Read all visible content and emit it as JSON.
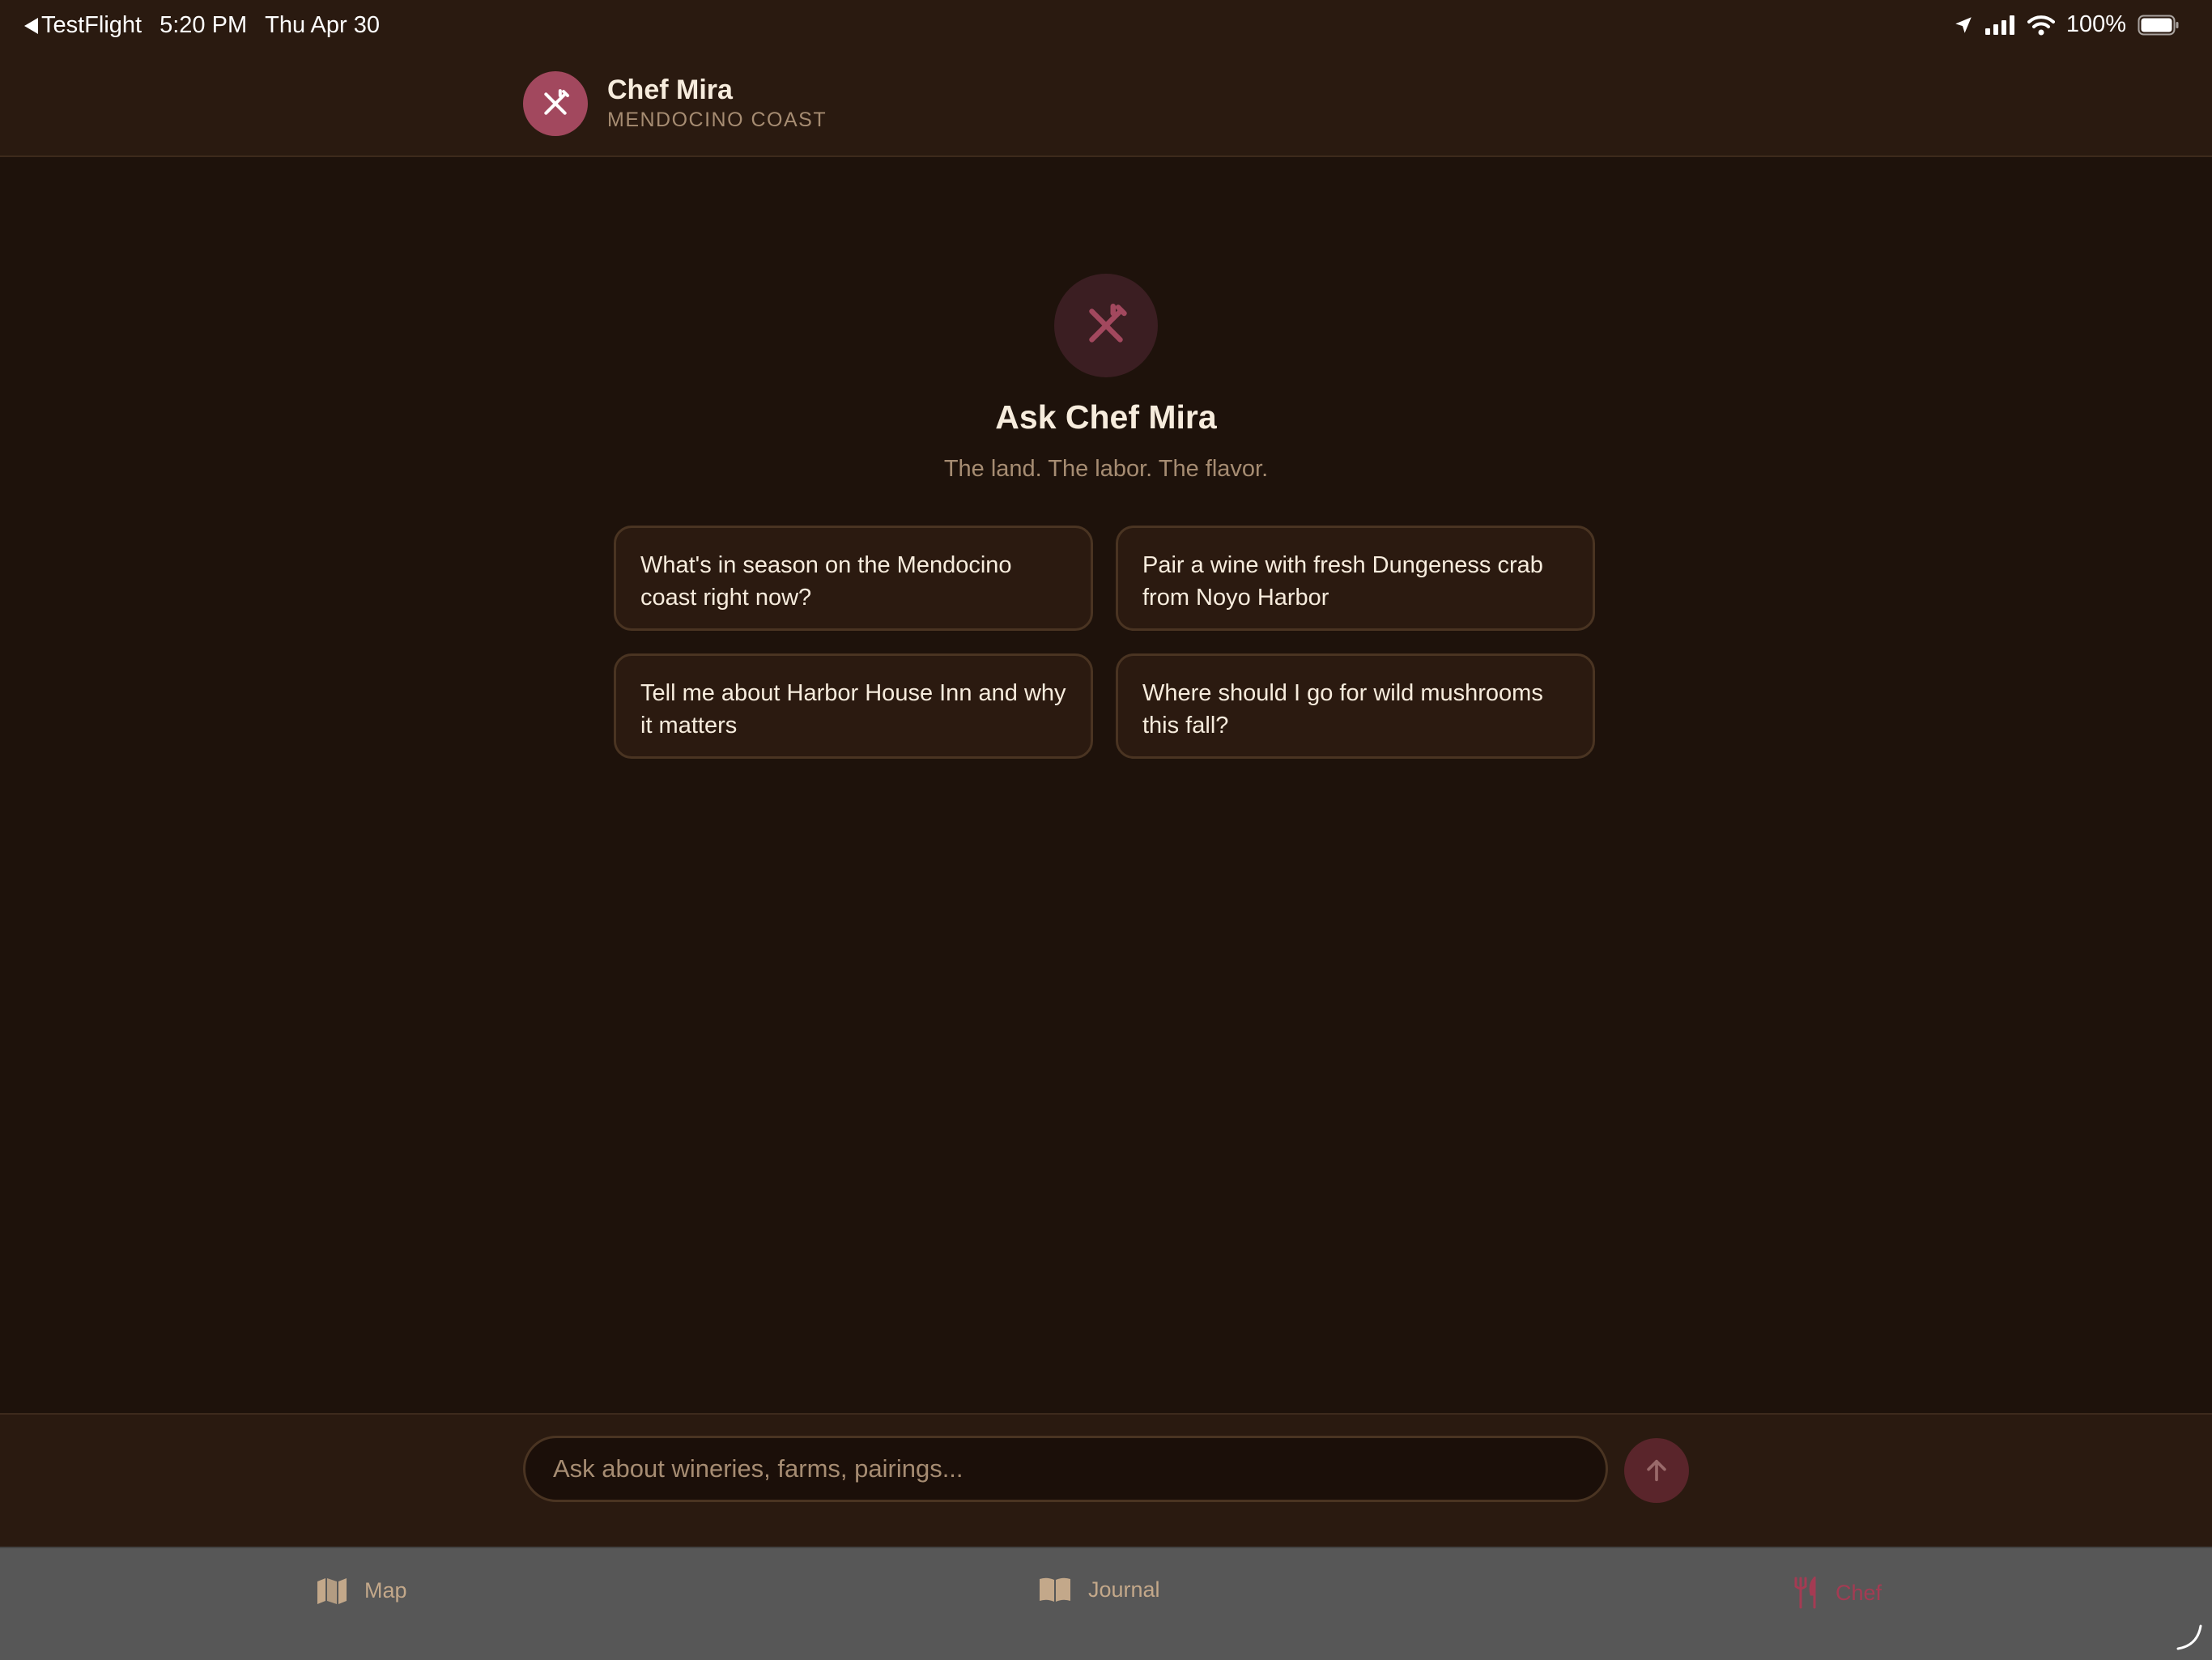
{
  "status_bar": {
    "back_app": "TestFlight",
    "time": "5:20 PM",
    "date": "Thu Apr 30",
    "battery": "100%",
    "icons": [
      "back-arrow-icon",
      "location-icon",
      "cellular-signal-icon",
      "wifi-icon",
      "battery-icon"
    ]
  },
  "header": {
    "title": "Chef Mira",
    "subtitle": "MENDOCINO COAST",
    "avatar_icon": "utensils-crossed-icon"
  },
  "hero": {
    "title": "Ask Chef Mira",
    "tagline": "The land. The labor. The flavor.",
    "avatar_icon": "utensils-crossed-icon"
  },
  "suggestions": [
    "What's in season on the Mendocino coast right now?",
    "Pair a wine with fresh Dungeness crab from Noyo Harbor",
    "Tell me about Harbor House Inn and why it matters",
    "Where should I go for wild mushrooms this fall?"
  ],
  "composer": {
    "placeholder": "Ask about wineries, farms, pairings...",
    "value": "",
    "send_icon": "arrow-up-icon"
  },
  "tabs": [
    {
      "label": "Map",
      "icon": "map-icon",
      "active": false
    },
    {
      "label": "Journal",
      "icon": "book-open-icon",
      "active": false
    },
    {
      "label": "Chef",
      "icon": "fork-knife-icon",
      "active": true
    }
  ],
  "colors": {
    "background": "#1e120b",
    "header_bg": "#2a1a10",
    "accent": "#a2485e",
    "active_tab": "#a43b53",
    "muted_text": "#a68c72",
    "tab_bar_bg": "#575757"
  }
}
